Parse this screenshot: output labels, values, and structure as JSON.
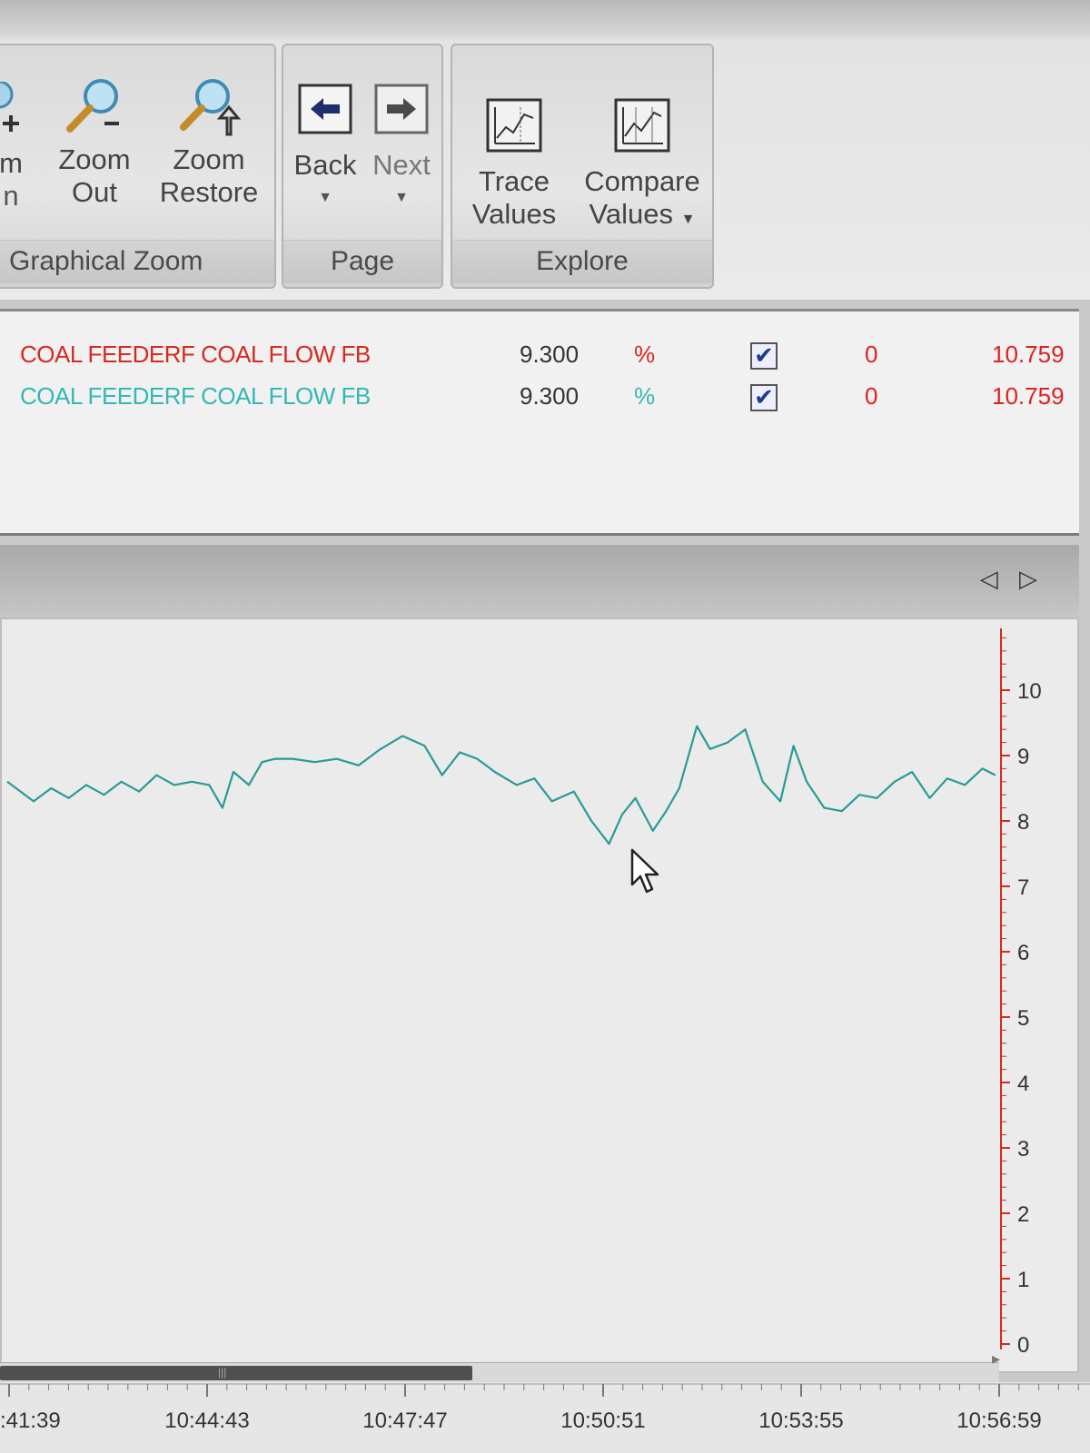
{
  "ribbon": {
    "zoom_in_partial_top": "m",
    "zoom_in_partial_bottom": "n",
    "zoom_out": {
      "line1": "Zoom",
      "line2": "Out",
      "icon": "zoom-out-icon"
    },
    "zoom_restore": {
      "line1": "Zoom",
      "line2": "Restore",
      "icon": "zoom-restore-icon"
    },
    "group_zoom": "Graphical Zoom",
    "back": "Back",
    "next": "Next",
    "group_page": "Page",
    "trace_values": {
      "line1": "Trace",
      "line2": "Values"
    },
    "compare_values": {
      "line1": "Compare",
      "line2": "Values"
    },
    "group_explore": "Explore"
  },
  "legend": {
    "rows": [
      {
        "name": "COAL FEEDERF COAL FLOW FB",
        "value": "9.300",
        "unit": "%",
        "checked": "✔",
        "min": "0",
        "max": "10.759",
        "color": "#d62a1e"
      },
      {
        "name": "COAL FEEDERF COAL FLOW FB",
        "value": "9.300",
        "unit": "%",
        "checked": "✔",
        "min": "0",
        "max": "10.759",
        "color": "#35b8b4"
      }
    ]
  },
  "chart_nav": "◁ ▷",
  "chart_data": {
    "type": "line",
    "y_ticks": [
      "0",
      "1",
      "2",
      "3",
      "4",
      "5",
      "6",
      "7",
      "8",
      "9",
      "10"
    ],
    "ylim": [
      0,
      10.759
    ],
    "x_ticks": [
      ":41:39",
      "10:44:43",
      "10:47:47",
      "10:50:51",
      "10:53:55",
      "10:56:59"
    ],
    "series": [
      {
        "color": "#2a9a96",
        "points": [
          [
            0.0,
            8.6
          ],
          [
            0.6,
            8.3
          ],
          [
            1.0,
            8.5
          ],
          [
            1.4,
            8.35
          ],
          [
            1.8,
            8.55
          ],
          [
            2.2,
            8.4
          ],
          [
            2.6,
            8.6
          ],
          [
            3.0,
            8.45
          ],
          [
            3.4,
            8.7
          ],
          [
            3.8,
            8.55
          ],
          [
            4.2,
            8.6
          ],
          [
            4.6,
            8.55
          ],
          [
            4.9,
            8.2
          ],
          [
            5.15,
            8.75
          ],
          [
            5.5,
            8.55
          ],
          [
            5.8,
            8.9
          ],
          [
            6.1,
            8.95
          ],
          [
            6.5,
            8.95
          ],
          [
            7.0,
            8.9
          ],
          [
            7.5,
            8.95
          ],
          [
            8.0,
            8.85
          ],
          [
            8.5,
            9.1
          ],
          [
            9.0,
            9.3
          ],
          [
            9.5,
            9.15
          ],
          [
            9.9,
            8.7
          ],
          [
            10.3,
            9.05
          ],
          [
            10.7,
            8.95
          ],
          [
            11.1,
            8.75
          ],
          [
            11.6,
            8.55
          ],
          [
            12.0,
            8.65
          ],
          [
            12.4,
            8.3
          ],
          [
            12.9,
            8.45
          ],
          [
            13.3,
            8.0
          ],
          [
            13.7,
            7.65
          ],
          [
            14.0,
            8.1
          ],
          [
            14.3,
            8.35
          ],
          [
            14.7,
            7.85
          ],
          [
            15.0,
            8.15
          ],
          [
            15.3,
            8.5
          ],
          [
            15.7,
            9.45
          ],
          [
            16.0,
            9.1
          ],
          [
            16.4,
            9.2
          ],
          [
            16.8,
            9.4
          ],
          [
            17.2,
            8.6
          ],
          [
            17.6,
            8.3
          ],
          [
            17.9,
            9.15
          ],
          [
            18.2,
            8.6
          ],
          [
            18.6,
            8.2
          ],
          [
            19.0,
            8.15
          ],
          [
            19.4,
            8.4
          ],
          [
            19.8,
            8.35
          ],
          [
            20.2,
            8.6
          ],
          [
            20.6,
            8.75
          ],
          [
            21.0,
            8.35
          ],
          [
            21.4,
            8.65
          ],
          [
            21.8,
            8.55
          ],
          [
            22.2,
            8.8
          ],
          [
            22.5,
            8.7
          ]
        ]
      }
    ]
  },
  "timeline_scroll": "▸",
  "scroll_grip": "|||"
}
